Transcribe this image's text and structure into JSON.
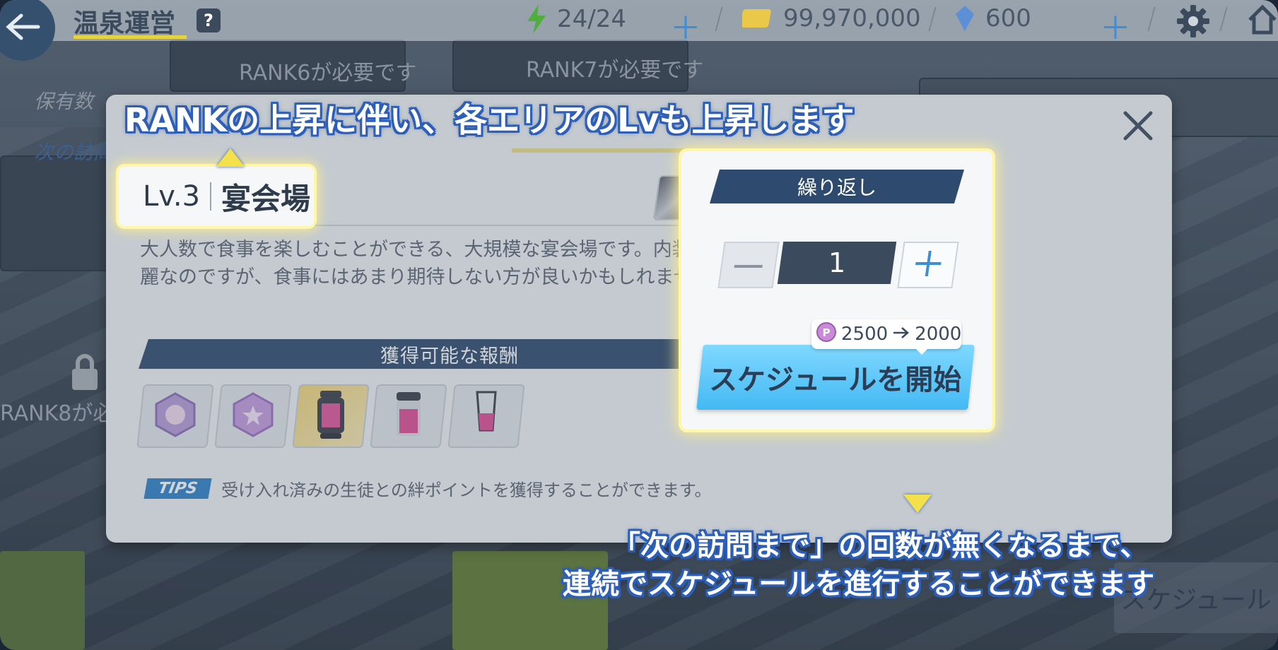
{
  "header": {
    "title": "温泉運営",
    "help": "?",
    "ap": "24/24",
    "credits": "99,970,000",
    "gems": "600"
  },
  "background": {
    "rank6_required": "RANK6が必要です",
    "rank7_required": "RANK7が必要です",
    "rank8_required": "RANK8が必",
    "holdings": "保有数",
    "next_visit": "次の訪問",
    "schedule": "スケジュール"
  },
  "modal": {
    "level": "Lv.3",
    "location": "宴会場",
    "description": "大人数で食事を楽しむことができる、大規模な宴会場です。内装は綺麗なのですが、食事にはあまり期待しない方が良いかもしれません。",
    "rewards_header": "獲得可能な報酬",
    "tips_badge": "TIPS",
    "tips_text": "受け入れ済みの生徒との絆ポイントを獲得することができます。",
    "repeat_header": "繰り返し",
    "repeat_value": "1",
    "cost_from": "2500",
    "cost_to": "2000",
    "start_button": "スケジュールを開始"
  },
  "captions": {
    "top": "RANKの上昇に伴い、各エリアのLvも上昇します",
    "bottom_line1": "「次の訪問まで」の回数が無くなるまで、",
    "bottom_line2": "連続でスケジュールを進行することができます"
  },
  "colors": {
    "accent_yellow": "#f4e04a",
    "header_navy": "#2e4a6e",
    "start_blue": "#44b9f3",
    "caption_outline": "#2d5fb8"
  },
  "icons": [
    "back-arrow-icon",
    "help-icon",
    "ap-bolt-icon",
    "credit-icon",
    "gem-icon",
    "gear-icon",
    "home-icon",
    "close-icon",
    "minus-icon",
    "plus-icon",
    "pyroxene-coin-icon",
    "arrow-right-icon",
    "lock-icon"
  ]
}
